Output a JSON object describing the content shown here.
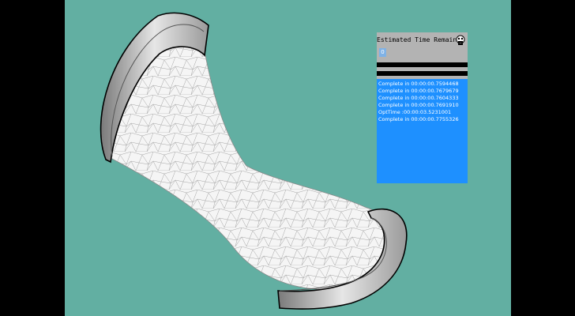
{
  "colors": {
    "background": "#62afa2",
    "log_background": "#1e90ff",
    "panel_background": "#b3b3b3"
  },
  "progress_window": {
    "title": "Estimated Time Remaini",
    "icon": "robot-face-icon",
    "percent": "0",
    "progress_bars": [
      0,
      0
    ],
    "log_lines": [
      "Complete in 00:00:00.7594468",
      "Complete in 00:00:00.7679679",
      "Complete in 00:00:00.7604333",
      "Complete in 00:00:00.7691910",
      "OptTime :00:00:03.5231001",
      "Complete in 00:00:00.7755326"
    ]
  }
}
